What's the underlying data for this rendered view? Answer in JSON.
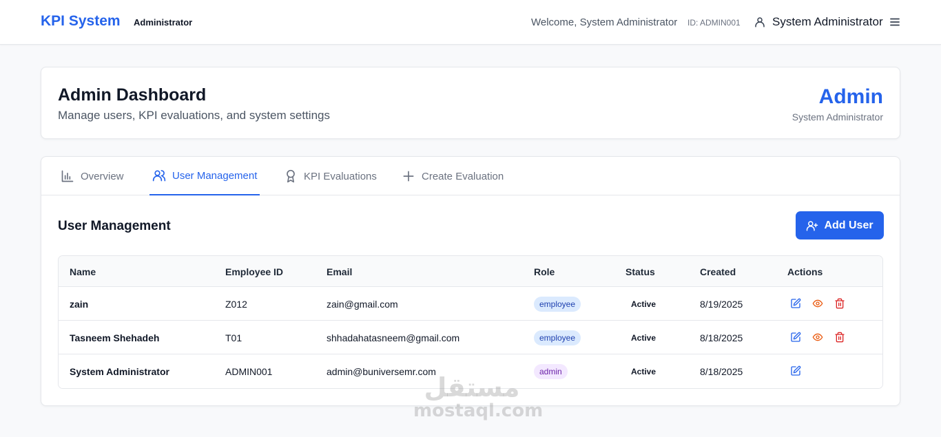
{
  "header": {
    "brand": "KPI System",
    "role": "Administrator",
    "welcome": "Welcome, System Administrator",
    "user_id": "ID: ADMIN001",
    "user_name": "System Administrator"
  },
  "hero": {
    "title": "Admin Dashboard",
    "subtitle": "Manage users, KPI evaluations, and system settings",
    "role_title": "Admin",
    "role_subtitle": "System Administrator"
  },
  "tabs": [
    {
      "label": "Overview",
      "icon": "bar-chart-icon",
      "active": false
    },
    {
      "label": "User Management",
      "icon": "users-icon",
      "active": true
    },
    {
      "label": "KPI Evaluations",
      "icon": "award-icon",
      "active": false
    },
    {
      "label": "Create Evaluation",
      "icon": "plus-icon",
      "active": false
    }
  ],
  "users_section": {
    "title": "User Management",
    "add_label": "Add User",
    "columns": [
      "Name",
      "Employee ID",
      "Email",
      "Role",
      "Status",
      "Created",
      "Actions"
    ],
    "rows": [
      {
        "name": "zain",
        "employee_id": "Z012",
        "email": "zain@gmail.com",
        "role": "employee",
        "status": "Active",
        "created": "8/19/2025"
      },
      {
        "name": "Tasneem Shehadeh",
        "employee_id": "T01",
        "email": "shhadahatasneem@gmail.com",
        "role": "employee",
        "status": "Active",
        "created": "8/18/2025"
      },
      {
        "name": "System Administrator",
        "employee_id": "ADMIN001",
        "email": "admin@buniversemr.com",
        "role": "admin",
        "status": "Active",
        "created": "8/18/2025"
      }
    ]
  },
  "colors": {
    "accent": "#2563eb",
    "danger": "#dc2626",
    "view": "#ea580c"
  },
  "watermark": {
    "arabic": "مستقل",
    "latin": "mostaql.com"
  }
}
